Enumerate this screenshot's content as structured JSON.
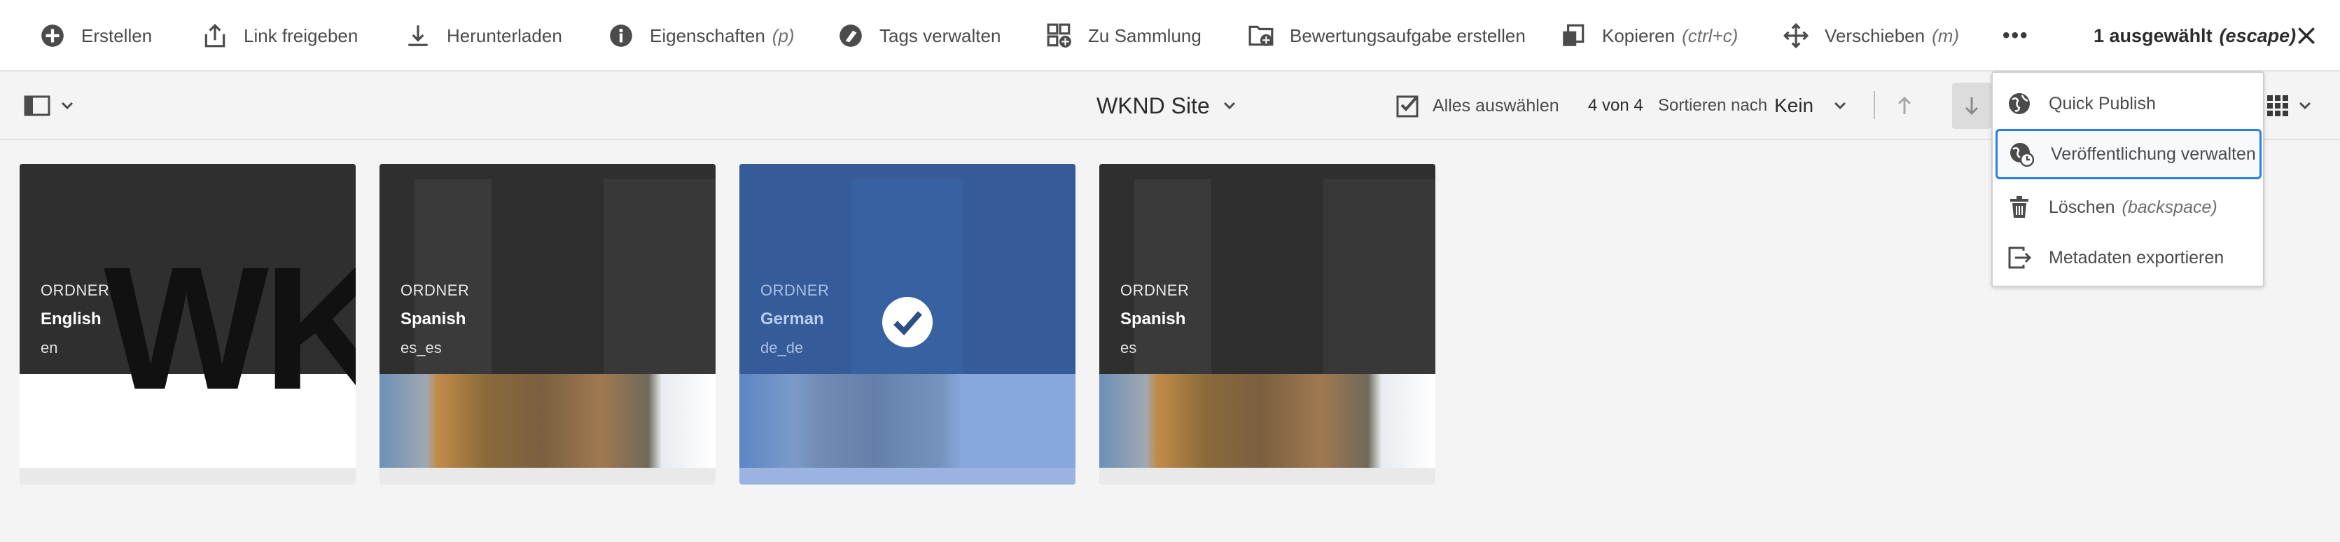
{
  "actionbar": {
    "create": "Erstellen",
    "share_link": "Link freigeben",
    "download": "Herunterladen",
    "properties": "Eigenschaften",
    "properties_hint": "(p)",
    "manage_tags": "Tags verwalten",
    "to_collection": "Zu Sammlung",
    "create_review_task": "Bewertungsaufgabe erstellen",
    "copy": "Kopieren",
    "copy_hint": "(ctrl+c)",
    "move": "Verschieben",
    "move_hint": "(m)",
    "more": "•••",
    "selected_count": "1 ausgewählt",
    "selected_hint": "(escape)"
  },
  "toolbar": {
    "title": "WKND Site",
    "select_all": "Alles auswählen",
    "count": "4 von 4",
    "sort_label": "Sortieren nach",
    "sort_value": "Kein"
  },
  "cards": [
    {
      "type": "ORDNER",
      "name": "English",
      "code": "en",
      "selected": false
    },
    {
      "type": "ORDNER",
      "name": "Spanish",
      "code": "es_es",
      "selected": false
    },
    {
      "type": "ORDNER",
      "name": "German",
      "code": "de_de",
      "selected": true
    },
    {
      "type": "ORDNER",
      "name": "Spanish",
      "code": "es",
      "selected": false
    }
  ],
  "menu": {
    "quick_publish": "Quick Publish",
    "manage_publication": "Veröffentlichung verwalten",
    "delete": "Löschen",
    "delete_hint": "(backspace)",
    "export_metadata": "Metadaten exportieren"
  },
  "colors": {
    "selection_blue": "#2680eb",
    "selection_overlay": "#2d5a9e",
    "card_dark": "#2f2f2f",
    "background": "#f4f4f4"
  },
  "icons": [
    "add-circle-icon",
    "share-icon",
    "download-icon",
    "info-icon",
    "tag-icon",
    "collection-add-icon",
    "folder-add-icon",
    "copy-icon",
    "move-icon",
    "more-icon",
    "close-icon",
    "rail-icon",
    "chevron-down-icon",
    "checkbox-icon",
    "arrow-up-icon",
    "arrow-down-icon",
    "grid-view-icon",
    "globe-icon",
    "globe-clock-icon",
    "trash-icon",
    "export-icon",
    "checkmark-icon"
  ]
}
